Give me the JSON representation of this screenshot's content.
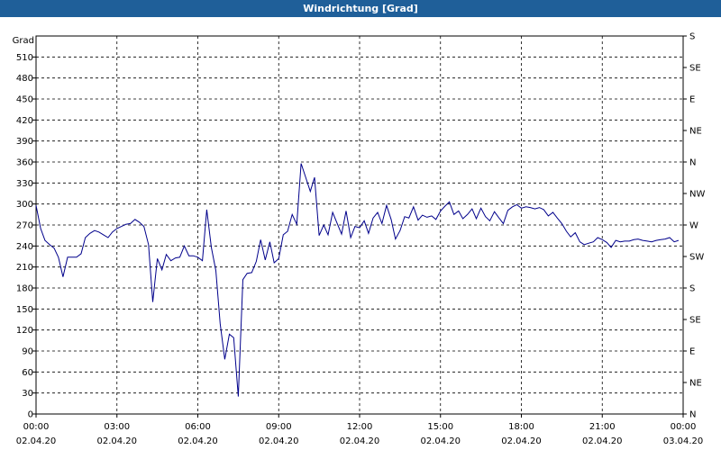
{
  "window": {
    "title": "Windrichtung [Grad]"
  },
  "chart_data": {
    "type": "line",
    "title": "Windrichtung [Grad]",
    "ylabel": "Grad",
    "ylim": [
      0,
      540
    ],
    "yticks": [
      0,
      30,
      60,
      90,
      120,
      150,
      180,
      210,
      240,
      270,
      300,
      330,
      360,
      390,
      420,
      450,
      480,
      510
    ],
    "xlim_hours": [
      0,
      24
    ],
    "xticks": [
      {
        "hour": 0,
        "time": "00:00",
        "date": "02.04.20"
      },
      {
        "hour": 3,
        "time": "03:00",
        "date": "02.04.20"
      },
      {
        "hour": 6,
        "time": "06:00",
        "date": "02.04.20"
      },
      {
        "hour": 9,
        "time": "09:00",
        "date": "02.04.20"
      },
      {
        "hour": 12,
        "time": "12:00",
        "date": "02.04.20"
      },
      {
        "hour": 15,
        "time": "15:00",
        "date": "02.04.20"
      },
      {
        "hour": 18,
        "time": "18:00",
        "date": "02.04.20"
      },
      {
        "hour": 21,
        "time": "21:00",
        "date": "02.04.20"
      },
      {
        "hour": 24,
        "time": "00:00",
        "date": "03.04.20"
      }
    ],
    "right_axis_labels": [
      {
        "value": 0,
        "label": "N"
      },
      {
        "value": 45,
        "label": "NE"
      },
      {
        "value": 90,
        "label": "E"
      },
      {
        "value": 135,
        "label": "SE"
      },
      {
        "value": 180,
        "label": "S"
      },
      {
        "value": 225,
        "label": "SW"
      },
      {
        "value": 270,
        "label": "W"
      },
      {
        "value": 315,
        "label": "NW"
      },
      {
        "value": 360,
        "label": "N"
      },
      {
        "value": 405,
        "label": "NE"
      },
      {
        "value": 450,
        "label": "E"
      },
      {
        "value": 495,
        "label": "SE"
      },
      {
        "value": 540,
        "label": "S"
      }
    ],
    "grid": true,
    "line_color": "#00008b",
    "x": [
      0,
      0.17,
      0.33,
      0.5,
      0.67,
      0.83,
      1.0,
      1.17,
      1.33,
      1.5,
      1.67,
      1.83,
      2.0,
      2.17,
      2.33,
      2.5,
      2.67,
      2.83,
      3.0,
      3.17,
      3.33,
      3.5,
      3.67,
      3.83,
      4.0,
      4.17,
      4.33,
      4.5,
      4.67,
      4.83,
      5.0,
      5.17,
      5.33,
      5.5,
      5.67,
      5.83,
      6.0,
      6.17,
      6.33,
      6.5,
      6.67,
      6.83,
      7.0,
      7.17,
      7.33,
      7.5,
      7.67,
      7.83,
      8.0,
      8.17,
      8.33,
      8.5,
      8.67,
      8.83,
      9.0,
      9.17,
      9.33,
      9.5,
      9.67,
      9.83,
      10.0,
      10.17,
      10.33,
      10.5,
      10.67,
      10.83,
      11.0,
      11.17,
      11.33,
      11.5,
      11.67,
      11.83,
      12.0,
      12.17,
      12.33,
      12.5,
      12.67,
      12.83,
      13.0,
      13.17,
      13.33,
      13.5,
      13.67,
      13.83,
      14.0,
      14.17,
      14.33,
      14.5,
      14.67,
      14.83,
      15.0,
      15.17,
      15.33,
      15.5,
      15.67,
      15.83,
      16.0,
      16.17,
      16.33,
      16.5,
      16.67,
      16.83,
      17.0,
      17.17,
      17.33,
      17.5,
      17.67,
      17.83,
      18.0,
      18.17,
      18.33,
      18.5,
      18.67,
      18.83,
      19.0,
      19.17,
      19.33,
      19.5,
      19.67,
      19.83,
      20.0,
      20.17,
      20.33,
      20.5,
      20.67,
      20.83,
      21.0,
      21.17,
      21.33,
      21.5,
      21.67,
      21.83,
      22.0,
      22.17,
      22.33,
      22.5,
      22.67,
      22.83,
      23.0,
      23.17,
      23.33,
      23.5,
      23.67,
      23.83
    ],
    "y": [
      298,
      265,
      248,
      242,
      237,
      224,
      196,
      224,
      224,
      224,
      229,
      252,
      258,
      262,
      260,
      256,
      252,
      260,
      265,
      268,
      271,
      272,
      278,
      274,
      268,
      242,
      160,
      222,
      206,
      228,
      219,
      223,
      224,
      240,
      226,
      226,
      224,
      219,
      292,
      238,
      205,
      129,
      78,
      114,
      109,
      25,
      192,
      201,
      202,
      218,
      249,
      220,
      246,
      216,
      222,
      256,
      261,
      285,
      271,
      358,
      338,
      318,
      338,
      255,
      270,
      256,
      288,
      272,
      257,
      290,
      252,
      268,
      266,
      276,
      258,
      280,
      288,
      272,
      298,
      278,
      250,
      262,
      282,
      280,
      296,
      277,
      284,
      281,
      283,
      278,
      290,
      297,
      303,
      285,
      290,
      279,
      285,
      293,
      279,
      294,
      282,
      276,
      289,
      280,
      272,
      291,
      296,
      299,
      294,
      296,
      295,
      293,
      295,
      292,
      283,
      288,
      280,
      272,
      261,
      253,
      259,
      246,
      242,
      244,
      246,
      252,
      249,
      245,
      238,
      248,
      246,
      247,
      247,
      249,
      250,
      248,
      247,
      246,
      248,
      249,
      250,
      252,
      246,
      248
    ]
  }
}
